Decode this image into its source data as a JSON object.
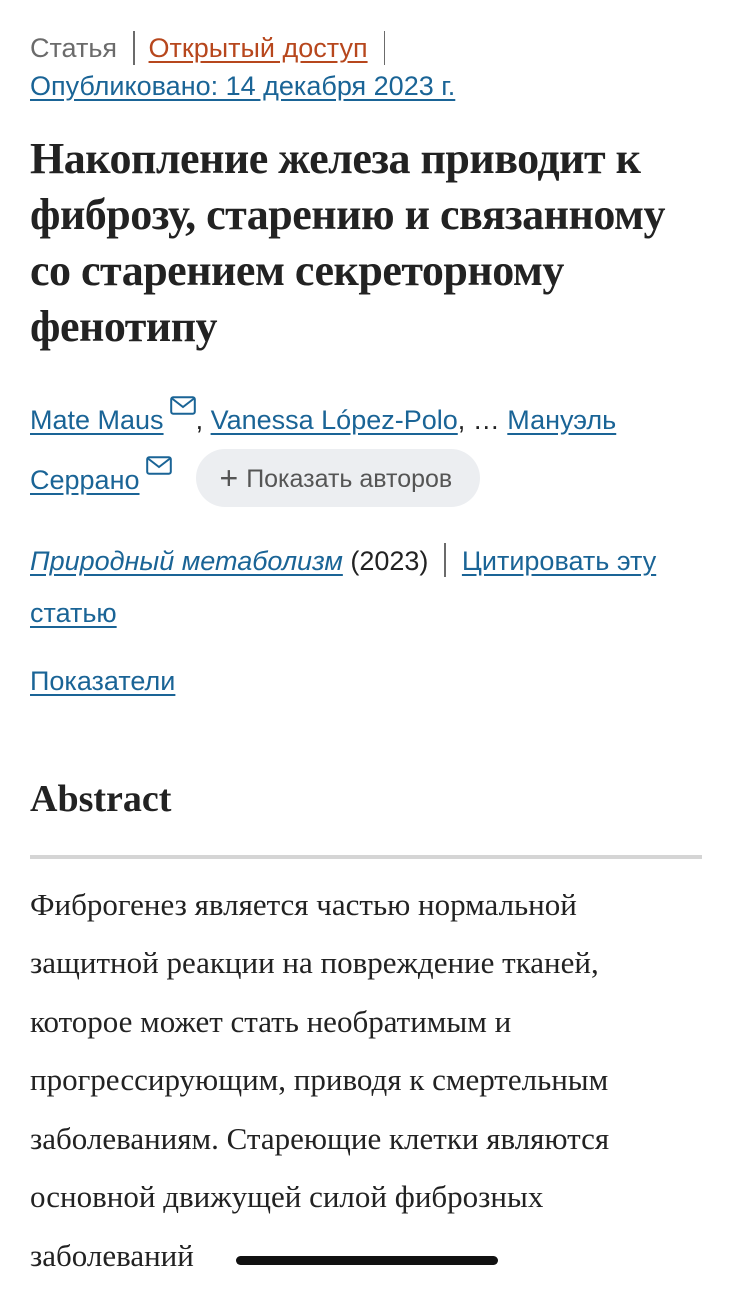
{
  "meta": {
    "article_type": "Статья",
    "open_access": "Открытый доступ",
    "published": "Опубликовано: 14 декабря 2023 г."
  },
  "article": {
    "title": "Накопление железа приводит к фиброзу, старению и связанному со старением секреторному фенотипу"
  },
  "authors": {
    "list": [
      "Mate Maus",
      "Vanessa López-Polo",
      "Мануэль Серрано"
    ],
    "comma": ",",
    "ellipsis": ", …",
    "mail_icon": "envelope-icon",
    "show_authors_icon": "plus-icon",
    "show_authors_plus": "+",
    "show_authors": "Показать авторов"
  },
  "journal": {
    "name": "Природный метаболизм",
    "year": "(2023)",
    "cite": "Цитировать эту статью"
  },
  "metrics": {
    "label": "Показатели"
  },
  "abstract": {
    "heading": "Abstract",
    "text": "Фиброгенез является частью нормальной защитной реакции на повреждение тканей, которое может стать необратимым и прогрессирующим, приводя к смертельным заболеваниям. Стареющие клетки являются основной движущей силой фиброзных заболеваний"
  },
  "colors": {
    "link": "#1a6496",
    "open_access": "#b7471d",
    "text": "#222222",
    "muted": "#6b6b6b",
    "pill_bg": "#eceef1"
  }
}
